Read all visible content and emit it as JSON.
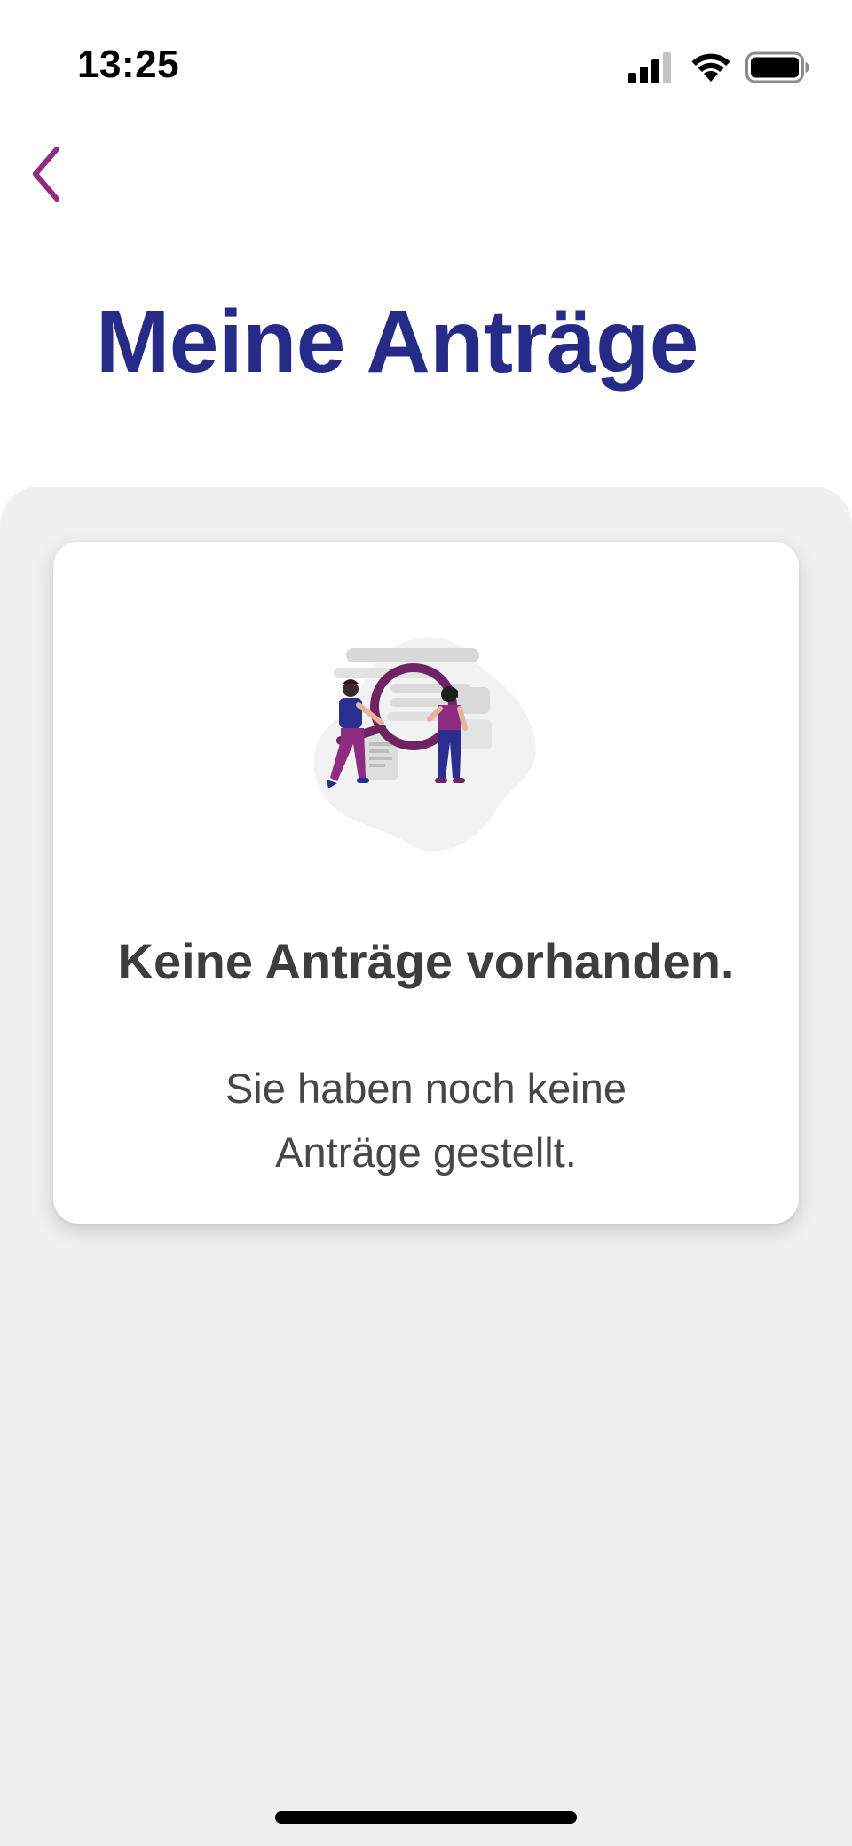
{
  "status_bar": {
    "time": "13:25",
    "icons": [
      "signal-icon",
      "wifi-icon",
      "battery-icon"
    ]
  },
  "header": {
    "back_icon": "chevron-left-icon",
    "title": "Meine Anträge"
  },
  "empty_state": {
    "illustration": "search-people-illustration",
    "title": "Keine Anträge vorhanden.",
    "description": "Sie haben noch keine Anträge gestellt."
  },
  "colors": {
    "title_blue": "#252B87",
    "accent_purple": "#8E2C82",
    "magnifier_purple": "#6E2462",
    "background_gray": "#F0F0F0",
    "text_dark": "#3D3D3D"
  }
}
